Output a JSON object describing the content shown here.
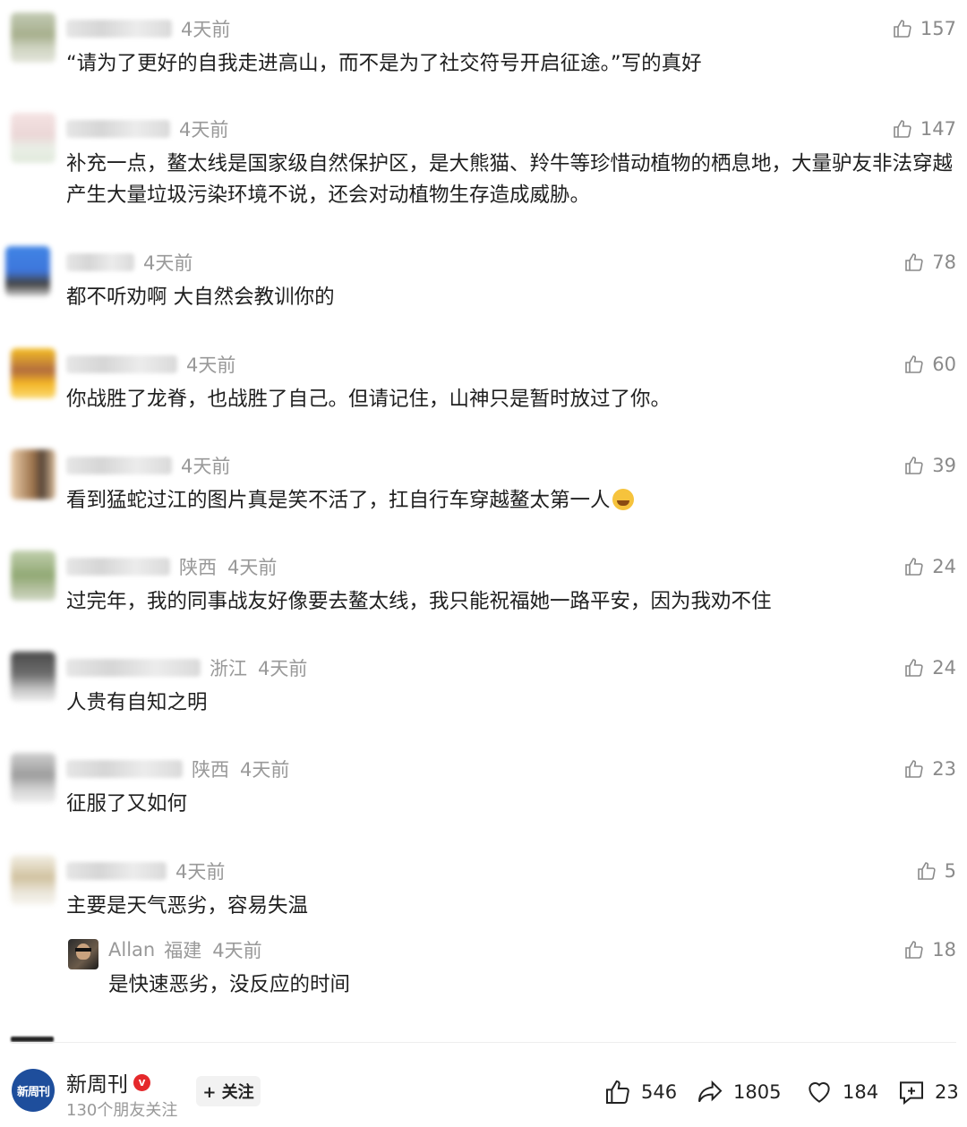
{
  "comments": [
    {
      "loc": "",
      "time": "4天前",
      "likes": "157",
      "text": "“请为了更好的自我走进高山，而不是为了社交符号开启征途。”写的真好"
    },
    {
      "loc": "",
      "time": "4天前",
      "likes": "147",
      "text": "补充一点，鳌太线是国家级自然保护区，是大熊猫、羚牛等珍惜动植物的栖息地，大量驴友非法穿越产生大量垃圾污染环境不说，还会对动植物生存造成威胁。"
    },
    {
      "loc": "",
      "time": "4天前",
      "likes": "78",
      "text": "都不听劝啊 大自然会教训你的"
    },
    {
      "loc": "",
      "time": "4天前",
      "likes": "60",
      "text": "你战胜了龙脊，也战胜了自己。但请记住，山神只是暂时放过了你。"
    },
    {
      "loc": "",
      "time": "4天前",
      "likes": "39",
      "text": "看到猛蛇过江的图片真是笑不活了，扛自行车穿越鳌太第一人"
    },
    {
      "loc": "陕西",
      "time": "4天前",
      "likes": "24",
      "text": "过完年，我的同事战友好像要去鳌太线，我只能祝福她一路平安，因为我劝不住"
    },
    {
      "loc": "浙江",
      "time": "4天前",
      "likes": "24",
      "text": "人贵有自知之明"
    },
    {
      "loc": "陕西",
      "time": "4天前",
      "likes": "23",
      "text": "征服了又如何"
    },
    {
      "loc": "",
      "time": "4天前",
      "likes": "5",
      "text": "主要是天气恶劣，容易失温"
    }
  ],
  "reply": {
    "name": "Allan",
    "loc": "福建",
    "time": "4天前",
    "likes": "18",
    "text": "是快速恶劣，没反应的时间"
  },
  "account": {
    "logo_text": "新周刊",
    "name": "新周刊",
    "followers": "130个朋友关注",
    "follow_label": "+ 关注"
  },
  "stats": {
    "likes": "546",
    "shares": "1805",
    "favorites": "184",
    "comments": "23"
  },
  "colors": {
    "verified": "#e5282b",
    "logo": "#1e4e9c"
  }
}
